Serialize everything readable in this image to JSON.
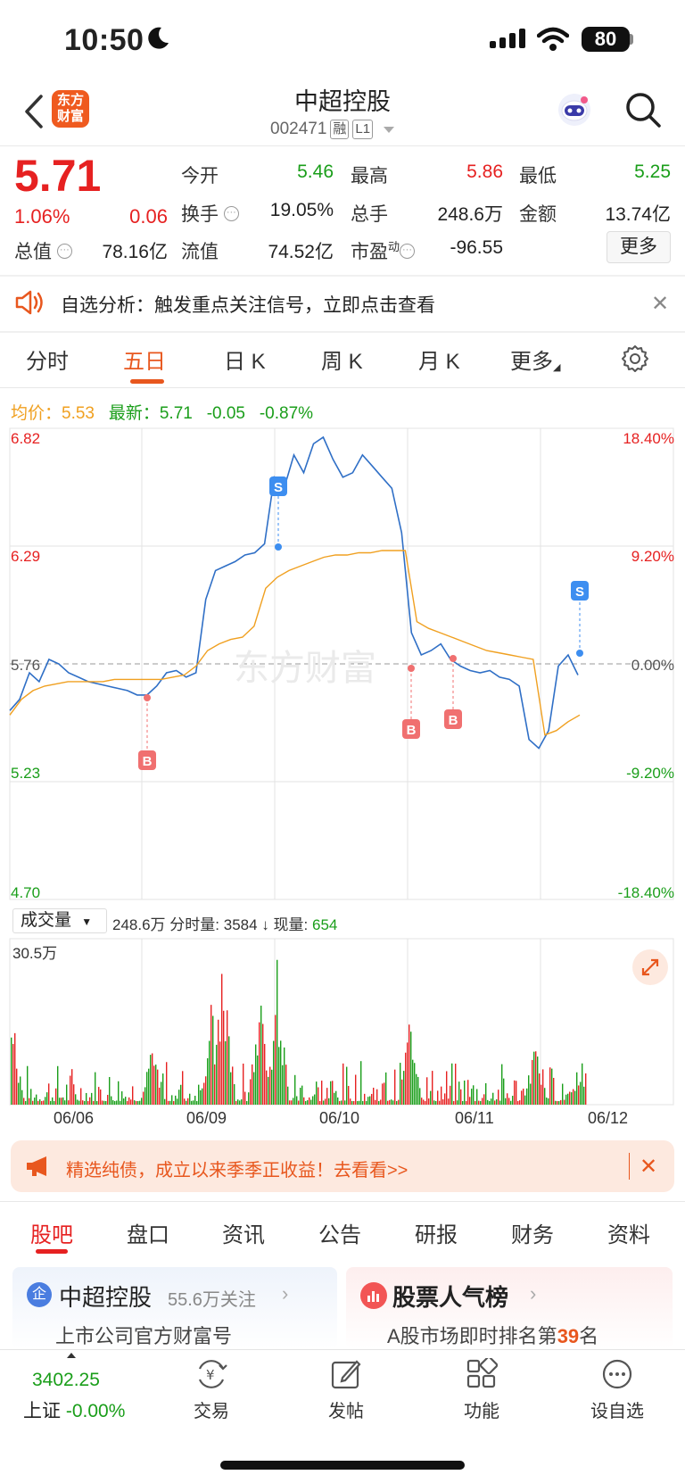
{
  "status_bar": {
    "time": "10:50",
    "battery": "80"
  },
  "header": {
    "logo_line1": "东方",
    "logo_line2": "财富",
    "stock_name": "中超控股",
    "stock_code": "002471",
    "tag_margin": "融",
    "tag_level": "L1"
  },
  "quote": {
    "price": "5.71",
    "change_pct": "1.06%",
    "change": "0.06",
    "fields": [
      {
        "label": "今开",
        "value": "5.46",
        "color": "green"
      },
      {
        "label": "最高",
        "value": "5.86",
        "color": "red"
      },
      {
        "label": "最低",
        "value": "5.25",
        "color": "green"
      },
      {
        "label": "换手",
        "value": "19.05%",
        "color": "black"
      },
      {
        "label": "总手",
        "value": "248.6万",
        "color": "black"
      },
      {
        "label": "金额",
        "value": "13.74亿",
        "color": "black"
      },
      {
        "label": "总值",
        "value": "78.16亿",
        "color": "black"
      },
      {
        "label": "流值",
        "value": "74.52亿",
        "color": "black"
      },
      {
        "label": "市盈",
        "sup": "动",
        "value": "-96.55",
        "color": "black"
      }
    ],
    "more_button": "更多"
  },
  "notice": {
    "text": "自选分析：触发重点关注信号，立即点击查看"
  },
  "chart_tabs": [
    "分时",
    "五日",
    "日 K",
    "周 K",
    "月 K",
    "更多"
  ],
  "active_chart_tab": "五日",
  "legend": {
    "avg_label": "均价：",
    "avg_value": "5.53",
    "latest_label": "最新：",
    "latest_value": "5.71",
    "latest_change": "-0.05",
    "latest_pct": "-0.87%"
  },
  "chart_data": {
    "type": "line",
    "price_axis": [
      "6.82",
      "6.29",
      "5.76",
      "5.23",
      "4.70"
    ],
    "pct_axis": [
      "18.40%",
      "9.20%",
      "0.00%",
      "-9.20%",
      "-18.40%"
    ],
    "ylim": [
      4.7,
      6.82
    ],
    "dates": [
      "06/06",
      "06/09",
      "06/10",
      "06/11",
      "06/12"
    ],
    "series": [
      {
        "name": "价格",
        "color": "#2f6fc6",
        "values": [
          5.55,
          5.6,
          5.72,
          5.68,
          5.78,
          5.76,
          5.72,
          5.7,
          5.68,
          5.67,
          5.66,
          5.65,
          5.64,
          5.62,
          5.62,
          5.66,
          5.72,
          5.73,
          5.7,
          5.72,
          6.05,
          6.18,
          6.2,
          6.22,
          6.25,
          6.26,
          6.3,
          6.6,
          6.55,
          6.7,
          6.62,
          6.75,
          6.78,
          6.68,
          6.6,
          6.62,
          6.7,
          6.65,
          6.6,
          6.55,
          6.35,
          5.9,
          5.8,
          5.82,
          5.85,
          5.78,
          5.75,
          5.73,
          5.72,
          5.73,
          5.7,
          5.69,
          5.66,
          5.42,
          5.38,
          5.46,
          5.75,
          5.8,
          5.71
        ]
      },
      {
        "name": "均价",
        "color": "#f0a020",
        "values": [
          5.53,
          5.6,
          5.64,
          5.66,
          5.67,
          5.68,
          5.68,
          5.68,
          5.68,
          5.69,
          5.69,
          5.69,
          5.69,
          5.69,
          5.7,
          5.71,
          5.75,
          5.82,
          5.85,
          5.87,
          5.88,
          5.93,
          6.1,
          6.15,
          6.18,
          6.2,
          6.22,
          6.24,
          6.25,
          6.25,
          6.26,
          6.26,
          6.27,
          6.27,
          6.27,
          5.95,
          5.92,
          5.9,
          5.88,
          5.86,
          5.84,
          5.82,
          5.81,
          5.8,
          5.79,
          5.78,
          5.44,
          5.46,
          5.5,
          5.53
        ]
      }
    ],
    "markers": [
      {
        "label": "B",
        "color": "#f07070"
      },
      {
        "label": "S",
        "color": "#3d8ef0"
      },
      {
        "label": "B",
        "color": "#f07070"
      },
      {
        "label": "B",
        "color": "#f07070"
      },
      {
        "label": "S",
        "color": "#3d8ef0"
      }
    ]
  },
  "volume": {
    "select_label": "成交量",
    "total": "248.6万",
    "minute_label": "分时量:",
    "minute_value": "3584",
    "current_label": "现量:",
    "current_value": "654",
    "max_label": "30.5万"
  },
  "ad": {
    "text": "精选纯债，成立以来季季正收益！去看看>>"
  },
  "bottom_tabs": [
    "股吧",
    "盘口",
    "资讯",
    "公告",
    "研报",
    "财务",
    "资料"
  ],
  "cards": [
    {
      "title": "中超控股",
      "follow": "55.6万关注",
      "sub": "上市公司官方财富号"
    },
    {
      "title": "股票人气榜",
      "sub_prefix": "A股市场即时排名第",
      "rank": "39",
      "sub_suffix": "名"
    }
  ],
  "index": {
    "value": "3402.25",
    "name": "上证",
    "pct": "-0.00%"
  },
  "nav": [
    "交易",
    "发帖",
    "功能",
    "设自选"
  ]
}
